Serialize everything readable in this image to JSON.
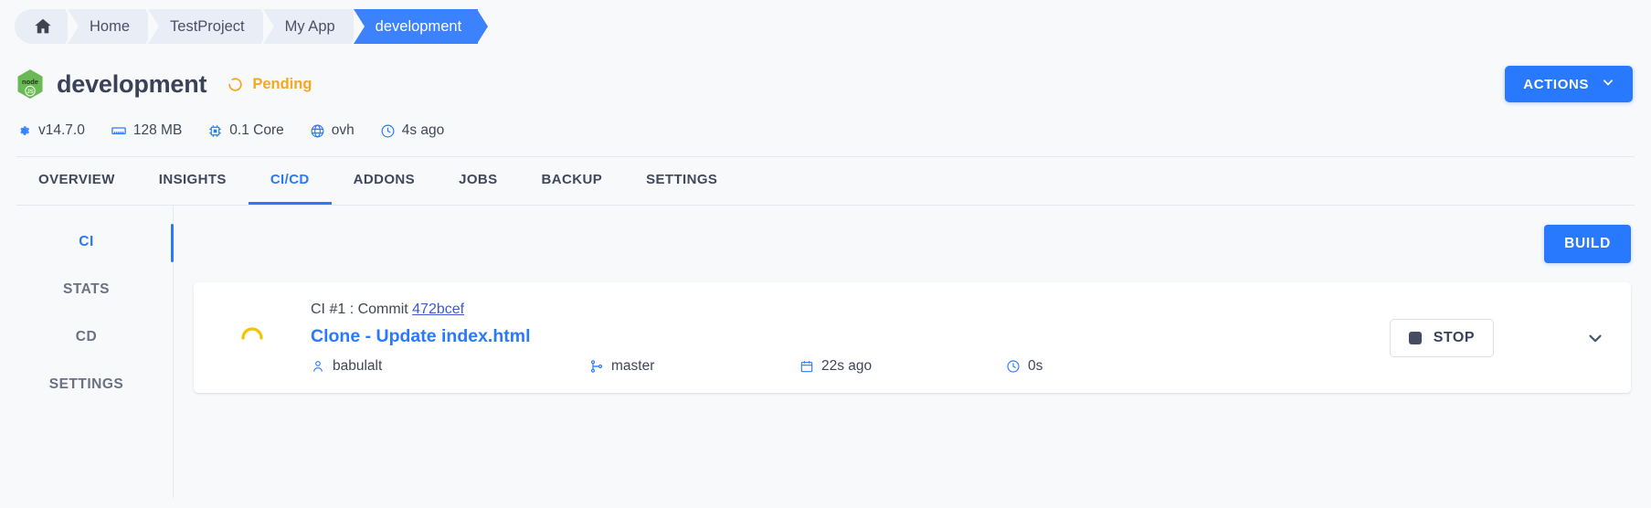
{
  "breadcrumb": {
    "home_icon": "home-icon",
    "items": [
      {
        "label": "Home",
        "active": false
      },
      {
        "label": "TestProject",
        "active": false
      },
      {
        "label": "My App",
        "active": false
      },
      {
        "label": "development",
        "active": true
      }
    ]
  },
  "header": {
    "logo_icon": "nodejs-logo",
    "title": "development",
    "status": {
      "icon": "spinner-icon",
      "label": "Pending",
      "color": "#f5a623"
    },
    "actions_button": {
      "label": "ACTIONS",
      "icon": "chevron-down-icon"
    }
  },
  "meta": [
    {
      "icon": "gear-icon",
      "value": "v14.7.0"
    },
    {
      "icon": "memory-icon",
      "value": "128 MB"
    },
    {
      "icon": "cpu-icon",
      "value": "0.1 Core"
    },
    {
      "icon": "globe-icon",
      "value": "ovh"
    },
    {
      "icon": "clock-icon",
      "value": "4s ago"
    }
  ],
  "tabs": [
    {
      "label": "OVERVIEW",
      "active": false
    },
    {
      "label": "INSIGHTS",
      "active": false
    },
    {
      "label": "CI/CD",
      "active": true
    },
    {
      "label": "ADDONS",
      "active": false
    },
    {
      "label": "JOBS",
      "active": false
    },
    {
      "label": "BACKUP",
      "active": false
    },
    {
      "label": "SETTINGS",
      "active": false
    }
  ],
  "side_nav": [
    {
      "label": "CI",
      "active": true
    },
    {
      "label": "STATS",
      "active": false
    },
    {
      "label": "CD",
      "active": false
    },
    {
      "label": "SETTINGS",
      "active": false
    }
  ],
  "content": {
    "build_button": "BUILD",
    "ci_card": {
      "status_icon": "spinner-icon",
      "line1_prefix": "CI #1 : Commit ",
      "commit_hash": "472bcef",
      "title": "Clone - Update index.html",
      "meta": [
        {
          "icon": "user-icon",
          "value": "babulalt"
        },
        {
          "icon": "branch-icon",
          "value": "master"
        },
        {
          "icon": "calendar-icon",
          "value": "22s ago"
        },
        {
          "icon": "clock-icon",
          "value": "0s"
        }
      ],
      "stop_button": {
        "label": "STOP",
        "icon": "stop-square-icon"
      },
      "expand_icon": "chevron-down-icon"
    }
  },
  "colors": {
    "accent": "#2979ff",
    "breadcrumb_active": "#3b82fc",
    "pending": "#f5a623",
    "link": "#3b5bd4",
    "page_bg": "#f8f9fb"
  }
}
